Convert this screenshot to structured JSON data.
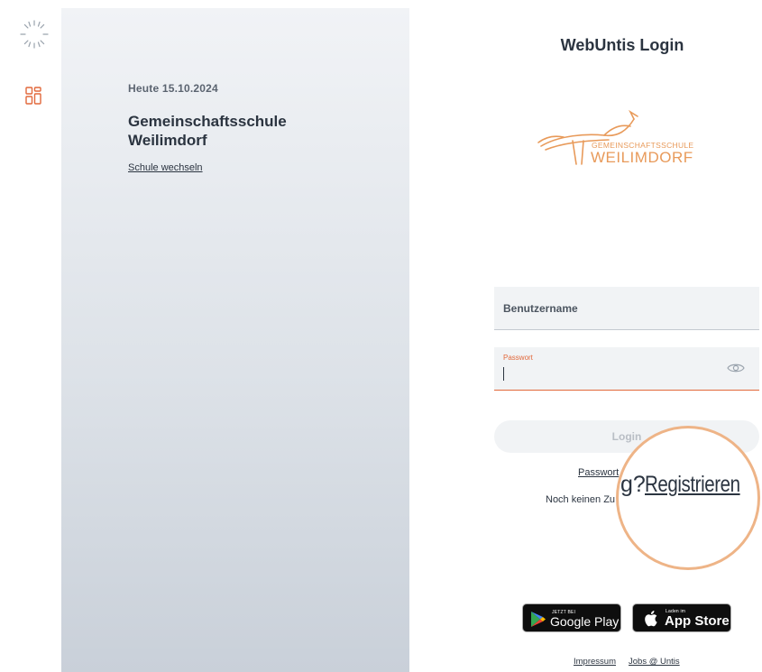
{
  "panel": {
    "today": "Heute 15.10.2024",
    "school_name": "Gemeinschaftsschule Weilimdorf",
    "change_school": "Schule wechseln"
  },
  "login": {
    "title": "WebUntis Login",
    "logo_line1": "GEMEINSCHAFTSSCHULE",
    "logo_line2": "WEILIMDORF",
    "username_placeholder": "Benutzername",
    "password_label": "Passwort",
    "password_value": "",
    "button_label": "Login",
    "forgot_link": "Passwort",
    "no_access_text": "Noch keinen Zu"
  },
  "magnifier": {
    "prefix": "g?",
    "link": "Registrieren"
  },
  "stores": {
    "google_small": "JETZT BEI",
    "google_big": "Google Play",
    "apple_small": "Laden im",
    "apple_big": "App Store"
  },
  "footer": {
    "impressum": "Impressum",
    "jobs": "Jobs @ Untis"
  },
  "icons": {
    "spinner": "loading-spinner-icon",
    "grid": "dashboard-grid-icon",
    "eye": "eye-icon",
    "google_play": "google-play-icon",
    "apple": "apple-icon"
  },
  "colors": {
    "accent": "#e2683b",
    "logo": "#e89a5a",
    "magnifier_ring": "#eeb487",
    "text": "#2b3440"
  }
}
